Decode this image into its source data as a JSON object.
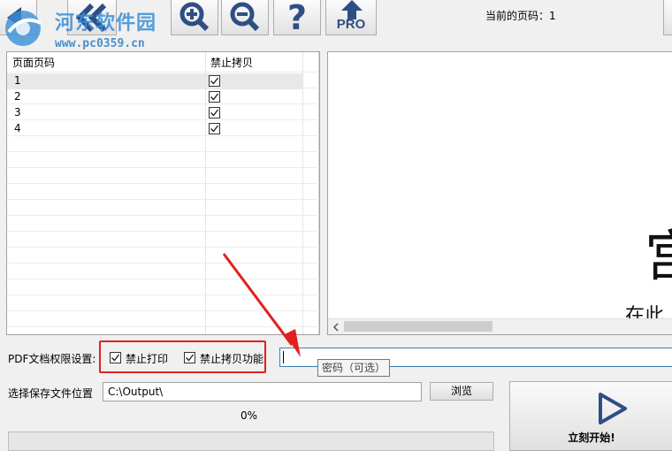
{
  "watermark": {
    "site_name": "河东软件园",
    "url": "www.pc0359.cn"
  },
  "toolbar": {
    "buttons": [
      "prev-page",
      "first-page",
      "zoom-in",
      "zoom-out",
      "help",
      "pro-upgrade"
    ],
    "pro_label": "PRO",
    "current_page_label": "当前的页码：1"
  },
  "table": {
    "columns": [
      "页面页码",
      "禁止拷贝"
    ],
    "rows": [
      {
        "page": "1",
        "no_copy": true
      },
      {
        "page": "2",
        "no_copy": true
      },
      {
        "page": "3",
        "no_copy": true
      },
      {
        "page": "4",
        "no_copy": true
      }
    ]
  },
  "preview": {
    "big_glyph": "宫",
    "partial_text": "在此"
  },
  "permissions": {
    "label": "PDF文档权限设置:",
    "no_print_label": "禁止打印",
    "no_print_checked": true,
    "no_copy_label": "禁止拷贝功能",
    "no_copy_checked": true,
    "password_value": "",
    "password_tooltip": "密码（可选）"
  },
  "save": {
    "label": "选择保存文件位置",
    "path": "C:\\Output\\",
    "browse_label": "浏览"
  },
  "progress": {
    "text": "0%",
    "value": 0
  },
  "start_button": {
    "label": "立刻开始!"
  },
  "colors": {
    "annotation_red": "#e02020",
    "progress_green": "#06b025",
    "icon_blue": "#2e4e84"
  }
}
